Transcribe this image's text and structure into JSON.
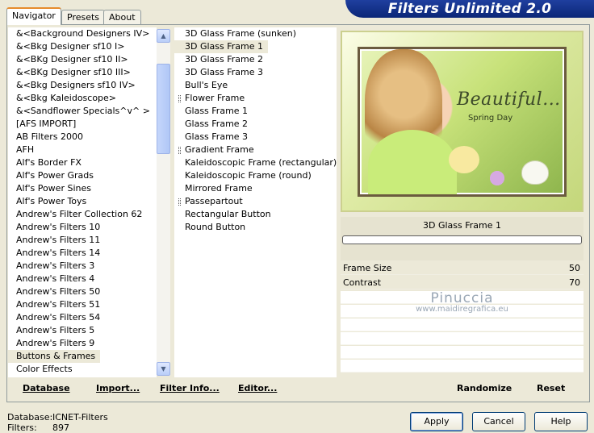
{
  "tabs": [
    "Navigator",
    "Presets",
    "About"
  ],
  "banner": "Filters Unlimited 2.0",
  "categories": [
    "&<Background Designers IV>",
    "&<Bkg Designer sf10 I>",
    "&<BKg Designer sf10 II>",
    "&<BKg Designer sf10 III>",
    "&<Bkg Designers sf10 IV>",
    "&<Bkg Kaleidoscope>",
    "&<Sandflower Specials^v^ >",
    "[AFS IMPORT]",
    "AB Filters 2000",
    "AFH",
    "Alf's Border FX",
    "Alf's Power Grads",
    "Alf's Power Sines",
    "Alf's Power Toys",
    "Andrew's Filter Collection 62",
    "Andrew's Filters 10",
    "Andrew's Filters 11",
    "Andrew's Filters 14",
    "Andrew's Filters 3",
    "Andrew's Filters 4",
    "Andrew's Filters 50",
    "Andrew's Filters 51",
    "Andrew's Filters 54",
    "Andrew's Filters 5",
    "Andrew's Filters 9",
    "Buttons & Frames",
    "Color Effects"
  ],
  "selected_category": "Buttons & Frames",
  "filters": [
    {
      "label": "3D Glass Frame (sunken)",
      "grip": false
    },
    {
      "label": "3D Glass Frame 1",
      "grip": false
    },
    {
      "label": "3D Glass Frame 2",
      "grip": false
    },
    {
      "label": "3D Glass Frame 3",
      "grip": false
    },
    {
      "label": "Bull's Eye",
      "grip": false
    },
    {
      "label": "Flower Frame",
      "grip": true
    },
    {
      "label": "Glass Frame 1",
      "grip": false
    },
    {
      "label": "Glass Frame 2",
      "grip": false
    },
    {
      "label": "Glass Frame 3",
      "grip": false
    },
    {
      "label": "Gradient Frame",
      "grip": true
    },
    {
      "label": "Kaleidoscopic Frame (rectangular)",
      "grip": false
    },
    {
      "label": "Kaleidoscopic Frame (round)",
      "grip": false
    },
    {
      "label": "Mirrored Frame",
      "grip": false
    },
    {
      "label": "Passepartout",
      "grip": true
    },
    {
      "label": "Rectangular Button",
      "grip": false
    },
    {
      "label": "Round Button",
      "grip": false
    }
  ],
  "selected_filter": "3D Glass Frame 1",
  "preview": {
    "title": "Beautiful...",
    "subtitle": "Spring Day"
  },
  "filter_name": "3D Glass Frame 1",
  "params": [
    {
      "label": "Frame Size",
      "value": "50"
    },
    {
      "label": "Contrast",
      "value": "70"
    }
  ],
  "watermark": {
    "name": "Pinuccia",
    "site": "www.maidiregrafica.eu"
  },
  "bottom_links": {
    "database": "Database",
    "import": "Import...",
    "filter_info": "Filter Info...",
    "editor": "Editor...",
    "randomize": "Randomize",
    "reset": "Reset"
  },
  "status": {
    "database_label": "Database:",
    "database_value": "ICNET-Filters",
    "filters_label": "Filters:",
    "filters_value": "897"
  },
  "buttons": {
    "apply": "Apply",
    "cancel": "Cancel",
    "help": "Help"
  },
  "icons": {
    "scroll_up": "arrow-up-icon",
    "scroll_down": "arrow-down-icon"
  }
}
